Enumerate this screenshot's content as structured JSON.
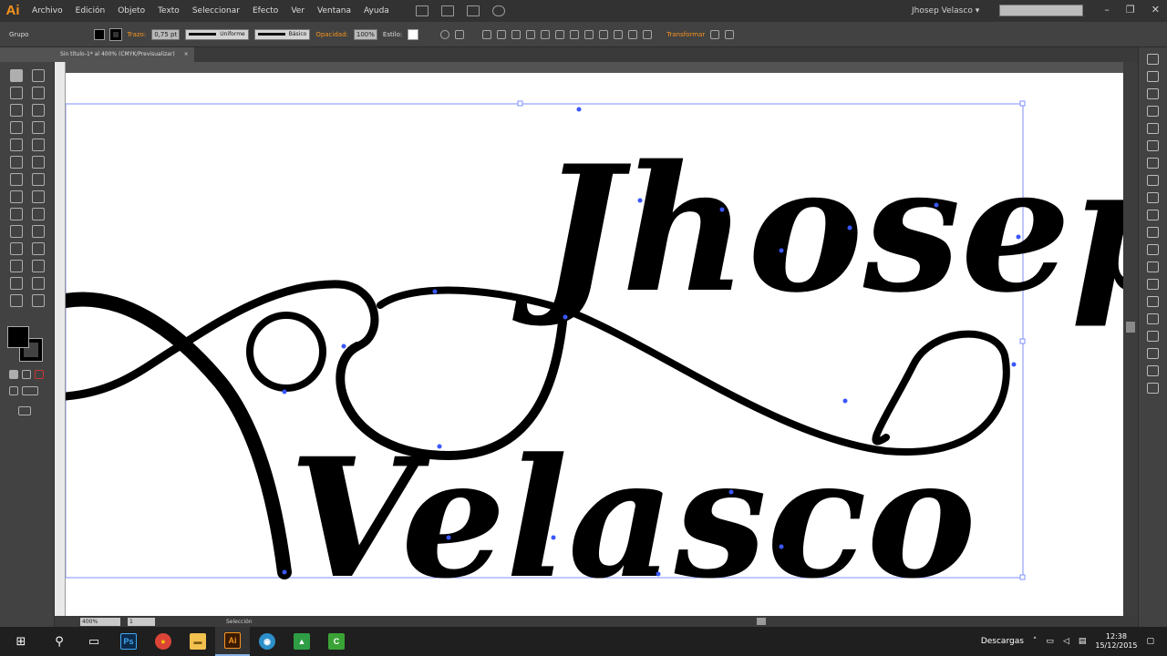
{
  "app": {
    "logo": "Ai",
    "user": "Jhosep Velasco",
    "user_caret": "▾"
  },
  "menu": [
    "Archivo",
    "Edición",
    "Objeto",
    "Texto",
    "Seleccionar",
    "Efecto",
    "Ver",
    "Ventana",
    "Ayuda"
  ],
  "window_controls": {
    "minimize": "–",
    "maximize": "❐",
    "close": "✕"
  },
  "control_bar": {
    "selection_label": "Grupo",
    "stroke_label": "Trazo:",
    "stroke_weight": "0,75 pt",
    "stroke_profile": "Uniforme",
    "brush_def": "Básico",
    "opacity_label": "Opacidad:",
    "opacity_value": "100%",
    "style_label": "Estilo:",
    "transform_label": "Transformar"
  },
  "document_tab": {
    "title": "Sin título-1* al 400% (CMYK/Previsualizar)",
    "close": "×"
  },
  "artwork": {
    "line1": "Jhosep",
    "line2": "Velasco"
  },
  "status_bar": {
    "zoom": "400%",
    "page": "1",
    "tool": "Selección"
  },
  "taskbar": {
    "items": [
      {
        "icon": "windows-start-icon",
        "label": "⊞"
      },
      {
        "icon": "search-icon",
        "label": "⚲"
      },
      {
        "icon": "task-view-icon",
        "label": "▭"
      },
      {
        "icon": "photoshop-icon",
        "label": "Ps"
      },
      {
        "icon": "chrome-icon",
        "label": "●"
      },
      {
        "icon": "file-explorer-icon",
        "label": "▬"
      },
      {
        "icon": "illustrator-icon",
        "label": "Ai"
      },
      {
        "icon": "app-blue-icon",
        "label": "◉"
      },
      {
        "icon": "app-green-icon",
        "label": "▲"
      },
      {
        "icon": "camtasia-icon",
        "label": "C"
      }
    ],
    "downloads": "Descargas",
    "time": "12:38",
    "date": "15/12/2015"
  },
  "colors": {
    "accent": "#f7941d",
    "selection": "#3a57ff",
    "ink": "#000000"
  }
}
